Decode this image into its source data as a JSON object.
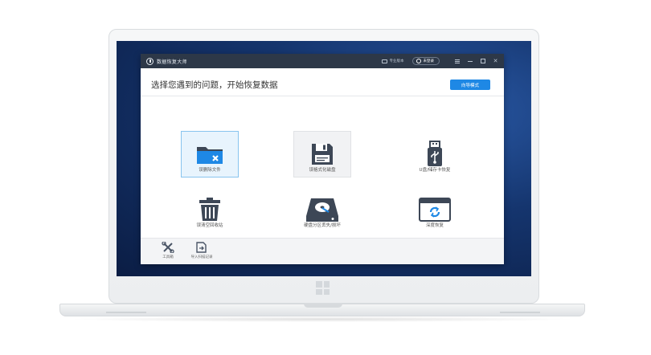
{
  "window": {
    "title": "数据恢复大师",
    "link_label": "专业版本",
    "login_label": "未登录"
  },
  "header": {
    "title": "选择您遇到的问题，开始恢复数据",
    "wizard_button": "向导模式"
  },
  "options": [
    {
      "label": "误删除文件",
      "icon": "folder-delete-icon",
      "state": "selected"
    },
    {
      "label": "误格式化磁盘",
      "icon": "floppy-disk-icon",
      "state": "hover"
    },
    {
      "label": "U盘/储存卡恢复",
      "icon": "usb-drive-icon",
      "state": "normal"
    },
    {
      "label": "误清空回收站",
      "icon": "trash-bin-icon",
      "state": "normal"
    },
    {
      "label": "硬盘分区丢失/损坏",
      "icon": "hard-disk-icon",
      "state": "normal"
    },
    {
      "label": "深度恢复",
      "icon": "deep-recovery-icon",
      "state": "normal"
    }
  ],
  "footer": {
    "tools": [
      {
        "label": "工具箱",
        "icon": "toolbox-icon"
      },
      {
        "label": "导入扫描记录",
        "icon": "import-record-icon"
      }
    ]
  },
  "colors": {
    "accent": "#1e88e5",
    "titlebar": "#2d3848",
    "icon": "#3d4756",
    "selected_bg": "#e8f4fd"
  }
}
